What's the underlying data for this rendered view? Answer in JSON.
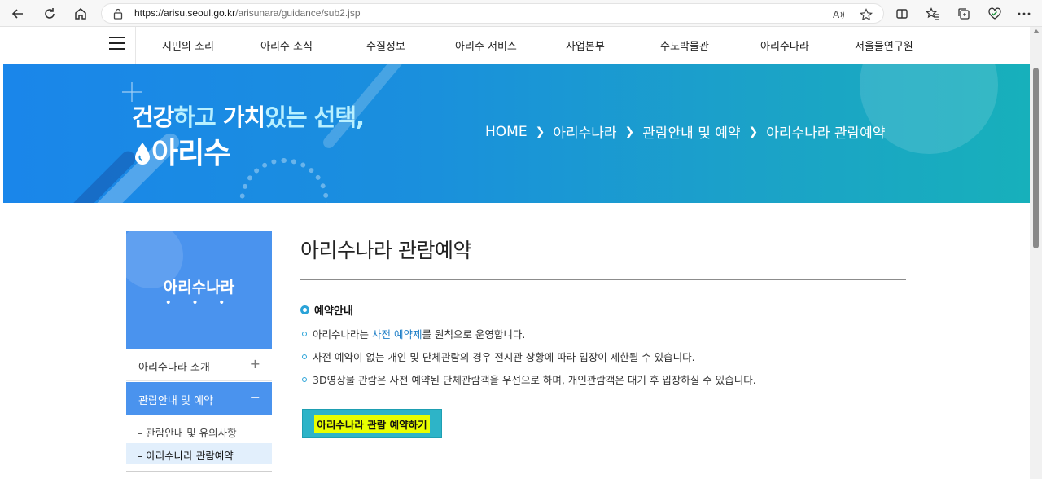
{
  "browser": {
    "url_host": "https://arisu.seoul.go.kr",
    "url_path": "/arisunara/guidance/sub2.jsp"
  },
  "nav": {
    "menu": [
      "시민의 소리",
      "아리수 소식",
      "수질정보",
      "아리수 서비스",
      "사업본부",
      "수도박물관",
      "아리수나라",
      "서울물연구원"
    ]
  },
  "banner": {
    "slogan_part1": "건강",
    "slogan_part2": "하고 ",
    "slogan_part3": "가치",
    "slogan_part4": "있는 선택,",
    "logo_text": "아리수",
    "breadcrumbs": [
      "HOME",
      "아리수나라",
      "관람안내 및 예약",
      "아리수나라 관람예약"
    ]
  },
  "sidebar": {
    "title": "아리수나라",
    "dots": "• • •",
    "items": [
      {
        "label": "아리수나라 소개",
        "toggle": "+"
      },
      {
        "label": "관람안내 및 예약",
        "toggle": "−"
      }
    ],
    "sub_items": [
      {
        "label": "관람안내 및 유의사항"
      },
      {
        "label": "아리수나라 관람예약"
      }
    ],
    "sub_marker": "–"
  },
  "main": {
    "title": "아리수나라 관람예약",
    "section_label": "예약안내",
    "line1_before": "아리수나라는 ",
    "line1_em": "사전 예약제",
    "line1_after": "를 원칙으로 운영합니다.",
    "line2": "사전 예약이 없는 개인 및 단체관람의 경우 전시관 상황에 따라 입장이 제한될 수 있습니다.",
    "line3": "3D영상물 관람은 사전 예약된 단체관람객을 우선으로 하며, 개인관람객은 대기 후 입장하실 수 있습니다.",
    "reserve_button": "아리수나라 관람 예약하기"
  },
  "colors": {
    "sidebar_blue": "#4a93ee",
    "accent_cyan": "#2aa3d8",
    "button_bg": "#2db4c8",
    "button_highlight": "#e8ff00"
  },
  "icons": [
    "back-icon",
    "refresh-icon",
    "home-icon",
    "lock-icon",
    "read-aloud-icon",
    "favorite-star-icon",
    "split-screen-icon",
    "favorites-icon",
    "collections-icon",
    "browser-essentials-icon",
    "more-icon",
    "hamburger-icon"
  ]
}
